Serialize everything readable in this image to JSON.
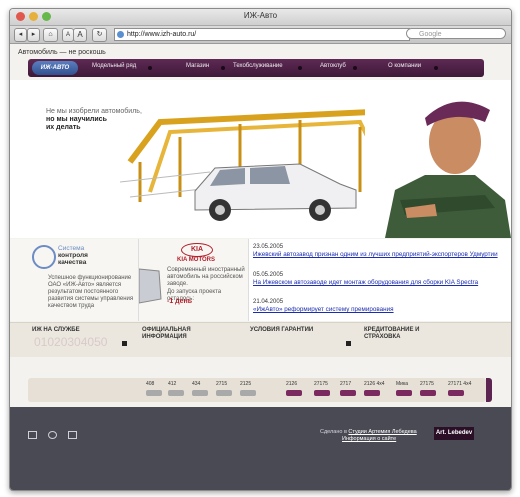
{
  "window": {
    "title": "ИЖ-Авто"
  },
  "toolbar": {
    "back": "◂",
    "forward": "▸",
    "home": "⌂",
    "text_small": "A",
    "text_big": "A",
    "reload": "↻",
    "address": "http://www.izh-auto.ru/",
    "search_placeholder": "Google"
  },
  "page": {
    "slogan": "Автомобиль — не роскошь",
    "nav": {
      "logo": "ИЖ-АВТО",
      "items": [
        {
          "label": "Модельный ряд"
        },
        {
          "label": "Магазин"
        },
        {
          "label": "Техобслуживание"
        },
        {
          "label": "Автоклуб"
        },
        {
          "label": "О компании"
        }
      ]
    },
    "hero": {
      "line1": "Не мы изобрели автомобиль,",
      "line2": "но мы научились",
      "line3": "их делать"
    },
    "quality": {
      "title1": "Система",
      "title2": "контроля",
      "title3": "качества",
      "text": "Успешное функционирование ОАО «ИЖ-Авто» является результатом постоянного развития системы управления качеством труда"
    },
    "kia": {
      "logo": "KIA",
      "brand": "KIA MOTORS",
      "text": "Современный иностранный автомобиль на российском заводе.",
      "countdown_label": "До запуска проекта осталось:",
      "countdown": "-1 день"
    },
    "news": [
      {
        "date": "23.05.2005",
        "text": "Ижевский автозавод признан одним из лучших предприятий-экспортеров Удмуртии"
      },
      {
        "date": "05.05.2005",
        "text": "На Ижевском автозаводе идет монтаж оборудования для сборки KIA Spectra"
      },
      {
        "date": "21.04.2005",
        "text": "«ИжАвто» реформирует систему премирования"
      }
    ],
    "strip": [
      {
        "label": "ИЖ НА СЛУЖБЕ",
        "sub": "01020304050"
      },
      {
        "label": "ОФИЦИАЛЬНАЯ ИНФОРМАЦИЯ"
      },
      {
        "label": "УСЛОВИЯ ГАРАНТИИ"
      },
      {
        "label": "КРЕДИТОВАНИЕ И СТРАХОВКА"
      }
    ],
    "timeline": [
      {
        "label": "408"
      },
      {
        "label": "412"
      },
      {
        "label": "434"
      },
      {
        "label": "2715"
      },
      {
        "label": "2125"
      },
      {
        "label": "2126"
      },
      {
        "label": "27175"
      },
      {
        "label": "2717"
      },
      {
        "label": "2126 4x4"
      },
      {
        "label": "Мика"
      },
      {
        "label": "27175"
      },
      {
        "label": "27171 4x4"
      }
    ],
    "footer": {
      "credit_prefix": "Сделано в ",
      "credit_link": "Студии Артемия Лебедева",
      "info_link": "Информация о сайте",
      "badge": "Art. Lebedev"
    }
  }
}
